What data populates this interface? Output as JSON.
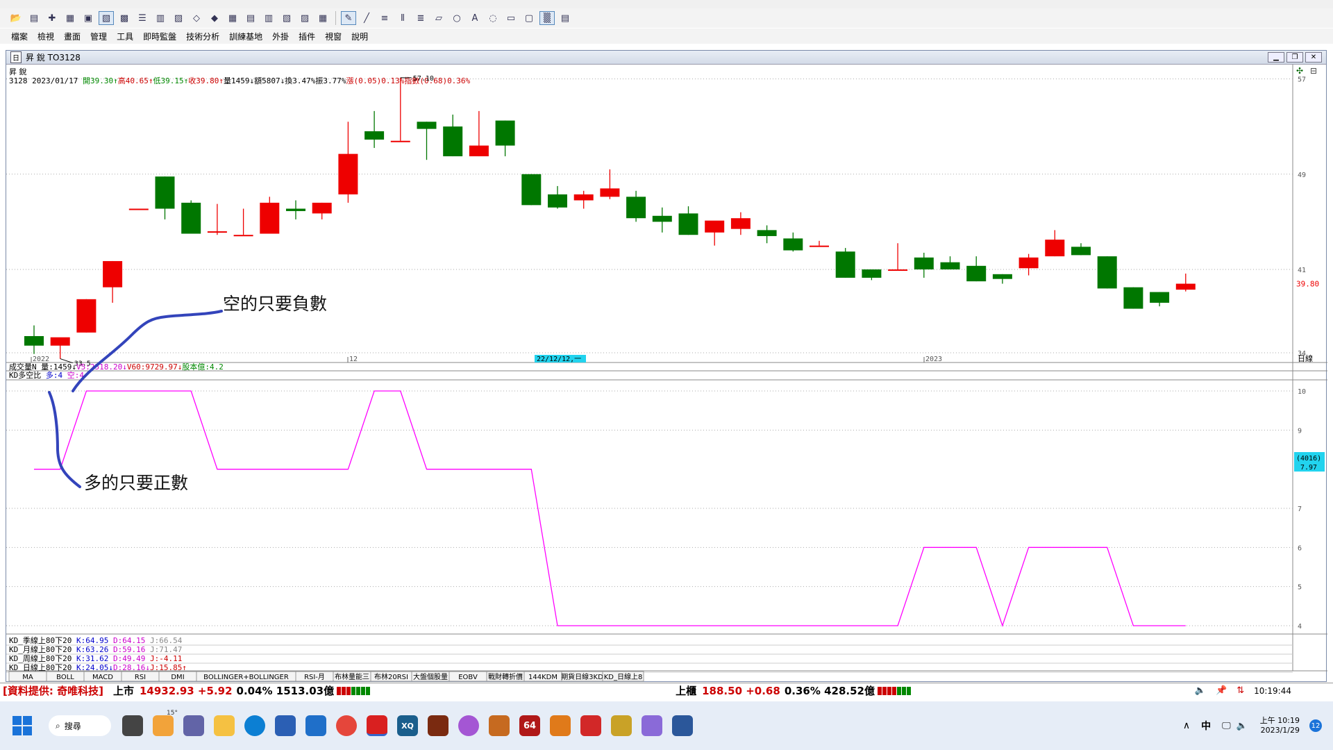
{
  "menu": [
    "檔案",
    "檢視",
    "畫面",
    "管理",
    "工具",
    "即時監盤",
    "技術分析",
    "訓練基地",
    "外掛",
    "插件",
    "視窗",
    "說明"
  ],
  "window": {
    "icon_label": "日",
    "title": "昇 銳 TO3128"
  },
  "chart_panel": {
    "name": "昇 銳",
    "info_line": [
      {
        "text": "3128 2023/01/17 ",
        "color": "#000000"
      },
      {
        "text": "開39.30↑",
        "color": "#008800"
      },
      {
        "text": "高40.65↑",
        "color": "#cc0000"
      },
      {
        "text": "低39.15↑",
        "color": "#008800"
      },
      {
        "text": "收39.80↑",
        "color": "#cc0000"
      },
      {
        "text": "量1459↓",
        "color": "#000000"
      },
      {
        "text": "額5807↓",
        "color": "#000000"
      },
      {
        "text": "換3.47%",
        "color": "#000000"
      },
      {
        "text": "振3.77%",
        "color": "#000000"
      },
      {
        "text": "漲(0.05)0.13%",
        "color": "#cc0000"
      },
      {
        "text": "指數(0.68)0.36%",
        "color": "#cc0000"
      }
    ],
    "price_ticks": [
      "57",
      "49",
      "41",
      "34"
    ],
    "last_price": "39.80",
    "high_label": "57.10",
    "low_label": "33.5",
    "date_labels": [
      "2022",
      "12",
      "2023"
    ],
    "cursor_date": "22/12/12,一",
    "period": "日線",
    "volume_line": [
      {
        "text": "成交量N ",
        "color": "#000000"
      },
      {
        "text": "量:1459↓",
        "color": "#000000"
      },
      {
        "text": "V5:2518.20↓",
        "color": "#cc00cc"
      },
      {
        "text": "V60:9729.97↓",
        "color": "#cc0000"
      },
      {
        "text": "股本億:4.2",
        "color": "#008800"
      }
    ],
    "kd_title": [
      {
        "text": "KD多空比 ",
        "color": "#000000"
      },
      {
        "text": "多:4 ",
        "color": "#0000cc"
      },
      {
        "text": "空:4",
        "color": "#cc00cc"
      }
    ],
    "kd_ticks": [
      "10",
      "9",
      "7",
      "6",
      "5",
      "4"
    ],
    "kd_badge": [
      "(4016)",
      "7.97"
    ],
    "kd_lines": [
      [
        {
          "text": "KD_季線上80下20 ",
          "color": "#000000"
        },
        {
          "text": "K:64.95 ",
          "color": "#0000cc"
        },
        {
          "text": "D:64.15 ",
          "color": "#cc00cc"
        },
        {
          "text": "J:66.54",
          "color": "#888888"
        }
      ],
      [
        {
          "text": "KD_月線上80下20 ",
          "color": "#000000"
        },
        {
          "text": "K:63.26 ",
          "color": "#0000cc"
        },
        {
          "text": "D:59.16 ",
          "color": "#cc00cc"
        },
        {
          "text": "J:71.47",
          "color": "#888888"
        }
      ],
      [
        {
          "text": "KD_周線上80下20 ",
          "color": "#000000"
        },
        {
          "text": "K:31.62 ",
          "color": "#0000cc"
        },
        {
          "text": "D:49.49 ",
          "color": "#cc00cc"
        },
        {
          "text": "J:-4.11",
          "color": "#cc0000"
        }
      ],
      [
        {
          "text": "KD_日線上80下20 ",
          "color": "#000000"
        },
        {
          "text": "K:24.05↓",
          "color": "#0000cc"
        },
        {
          "text": "D:28.16↓",
          "color": "#cc00cc"
        },
        {
          "text": "J:15.85↑",
          "color": "#cc0000"
        }
      ]
    ],
    "bottom_tabs": [
      "MA",
      "BOLL",
      "MACD",
      "RSI",
      "DMI",
      "BOLLINGER+BOLLINGER",
      "RSI-月",
      "布林量能三",
      "布林20RSI",
      "大盤個股量",
      "EOBV",
      "戰財轉折價",
      "144KDM",
      "期貨日線3KD",
      "KD_日線上8"
    ]
  },
  "annotations": {
    "short": "空的只要負數",
    "long": "多的只要正數"
  },
  "status": {
    "source": "[資料提供: 奇唯科技]",
    "twse_label": "上市",
    "twse_value": "14932.93 +5.92",
    "twse_pct": "0.04% 1513.03億",
    "otc_label": "上櫃",
    "otc_value": "188.50 +0.68",
    "otc_pct": "0.36% 428.52億",
    "clock": "10:19:44"
  },
  "taskbar": {
    "search": "搜尋",
    "weather": "15°",
    "ime": "中",
    "time": "上午 10:19",
    "date": "2023/1/29",
    "notif": "12",
    "icon_64": "64",
    "icon_xq": "XQ"
  },
  "chart_data": {
    "type": "candlestick",
    "candles": [
      {
        "o": 35.4,
        "h": 36.3,
        "l": 33.9,
        "c": 34.6
      },
      {
        "o": 34.6,
        "h": 35.2,
        "l": 33.5,
        "c": 35.3
      },
      {
        "o": 35.7,
        "h": 38.5,
        "l": 35.7,
        "c": 38.5
      },
      {
        "o": 39.5,
        "h": 41.7,
        "l": 38.2,
        "c": 41.7
      },
      {
        "o": 46.1,
        "h": 46.1,
        "l": 46.1,
        "c": 46.1
      },
      {
        "o": 48.8,
        "h": 48.8,
        "l": 45.2,
        "c": 46.1
      },
      {
        "o": 46.6,
        "h": 46.8,
        "l": 44.0,
        "c": 44.0
      },
      {
        "o": 44.2,
        "h": 46.5,
        "l": 43.9,
        "c": 44.2
      },
      {
        "o": 43.9,
        "h": 46.1,
        "l": 43.9,
        "c": 43.9
      },
      {
        "o": 44.0,
        "h": 47.1,
        "l": 44.0,
        "c": 46.6
      },
      {
        "o": 46.1,
        "h": 46.8,
        "l": 45.2,
        "c": 45.9
      },
      {
        "o": 45.7,
        "h": 46.6,
        "l": 45.2,
        "c": 46.6
      },
      {
        "o": 47.3,
        "h": 53.4,
        "l": 46.6,
        "c": 50.7
      },
      {
        "o": 52.6,
        "h": 54.3,
        "l": 51.2,
        "c": 51.9
      },
      {
        "o": 51.8,
        "h": 57.1,
        "l": 51.8,
        "c": 51.8
      },
      {
        "o": 53.4,
        "h": 53.4,
        "l": 50.2,
        "c": 52.8
      },
      {
        "o": 53.0,
        "h": 54.0,
        "l": 50.5,
        "c": 50.5
      },
      {
        "o": 50.5,
        "h": 54.3,
        "l": 50.5,
        "c": 51.4
      },
      {
        "o": 53.5,
        "h": 53.5,
        "l": 50.5,
        "c": 51.4
      },
      {
        "o": 49.0,
        "h": 49.0,
        "l": 46.4,
        "c": 46.4
      },
      {
        "o": 47.3,
        "h": 48.0,
        "l": 46.1,
        "c": 46.2
      },
      {
        "o": 46.8,
        "h": 47.6,
        "l": 46.1,
        "c": 47.3
      },
      {
        "o": 47.1,
        "h": 49.4,
        "l": 46.9,
        "c": 47.8
      },
      {
        "o": 47.1,
        "h": 47.6,
        "l": 45.0,
        "c": 45.3
      },
      {
        "o": 45.5,
        "h": 46.2,
        "l": 44.1,
        "c": 45.0
      },
      {
        "o": 45.7,
        "h": 46.3,
        "l": 43.9,
        "c": 43.9
      },
      {
        "o": 44.1,
        "h": 44.6,
        "l": 43.0,
        "c": 45.1
      },
      {
        "o": 44.4,
        "h": 45.8,
        "l": 43.9,
        "c": 45.3
      },
      {
        "o": 44.3,
        "h": 44.7,
        "l": 43.2,
        "c": 43.8
      },
      {
        "o": 43.6,
        "h": 44.1,
        "l": 42.5,
        "c": 42.6
      },
      {
        "o": 43.0,
        "h": 43.4,
        "l": 43.0,
        "c": 43.0
      },
      {
        "o": 42.5,
        "h": 42.8,
        "l": 40.3,
        "c": 40.3
      },
      {
        "o": 41.0,
        "h": 41.0,
        "l": 40.1,
        "c": 40.3
      },
      {
        "o": 41.0,
        "h": 43.2,
        "l": 41.0,
        "c": 41.0
      },
      {
        "o": 42.0,
        "h": 42.4,
        "l": 40.3,
        "c": 41.0
      },
      {
        "o": 41.6,
        "h": 42.1,
        "l": 41.0,
        "c": 41.0
      },
      {
        "o": 41.3,
        "h": 42.1,
        "l": 40.0,
        "c": 40.0
      },
      {
        "o": 40.6,
        "h": 40.6,
        "l": 39.8,
        "c": 40.2
      },
      {
        "o": 41.1,
        "h": 42.3,
        "l": 40.5,
        "c": 42.0
      },
      {
        "o": 42.1,
        "h": 44.3,
        "l": 42.1,
        "c": 43.5
      },
      {
        "o": 42.9,
        "h": 43.2,
        "l": 42.2,
        "c": 42.2
      },
      {
        "o": 42.1,
        "h": 42.1,
        "l": 39.4,
        "c": 39.4
      },
      {
        "o": 39.5,
        "h": 39.5,
        "l": 37.7,
        "c": 37.7
      },
      {
        "o": 39.1,
        "h": 39.1,
        "l": 37.9,
        "c": 38.2
      },
      {
        "o": 39.3,
        "h": 40.65,
        "l": 39.15,
        "c": 39.8
      }
    ],
    "kd_ratio": [
      8,
      8,
      10,
      10,
      10,
      10,
      10,
      8,
      8,
      8,
      8,
      8,
      8,
      10,
      10,
      8,
      8,
      8,
      8,
      8,
      4,
      4,
      4,
      4,
      4,
      4,
      4,
      4,
      4,
      4,
      4,
      4,
      4,
      4,
      6,
      6,
      6,
      4,
      6,
      6,
      6,
      6,
      4,
      4,
      4
    ],
    "price_range": [
      34,
      57.5
    ],
    "kd_range": [
      4,
      10
    ]
  }
}
